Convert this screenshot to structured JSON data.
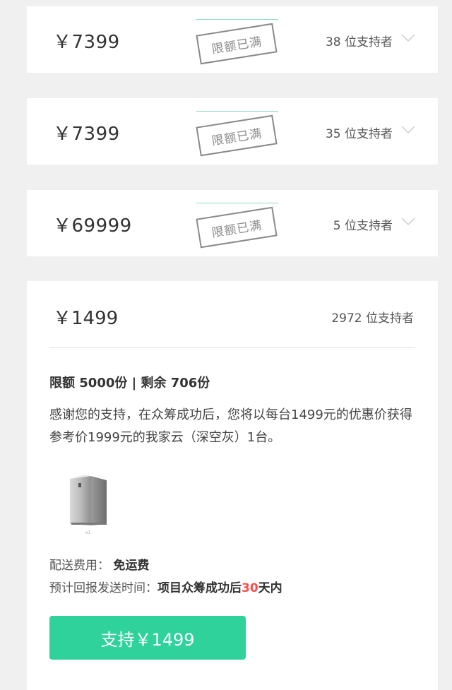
{
  "tiers": [
    {
      "price": "￥7399",
      "stamp": "限额已满",
      "backers": "38 位支持者"
    },
    {
      "price": "￥7399",
      "stamp": "限额已满",
      "backers": "35 位支持者"
    },
    {
      "price": "￥69999",
      "stamp": "限额已满",
      "backers": "5 位支持者"
    }
  ],
  "open_tier": {
    "price": "￥1499",
    "backers": "2972 位支持者",
    "limit_text": "限额 5000份 | 剩余 706份",
    "description": "感谢您的支持，在众筹成功后，您将以每台1499元的优惠价获得参考价1999元的我家云（深空灰）1台。",
    "product_qty": "x1",
    "shipping_label": "配送费用：",
    "shipping_value": "免运费",
    "time_label": "预计回报发送时间：",
    "time_prefix": "项目众筹成功后",
    "time_days": "30",
    "time_suffix": "天内",
    "button_label": "支持￥1499"
  },
  "colors": {
    "accent": "#2fd29b",
    "highlight": "#ff4d4d",
    "stamp": "#8a8a8a"
  },
  "icons": {
    "expand": "chevron-down-icon",
    "product": "product-image"
  }
}
